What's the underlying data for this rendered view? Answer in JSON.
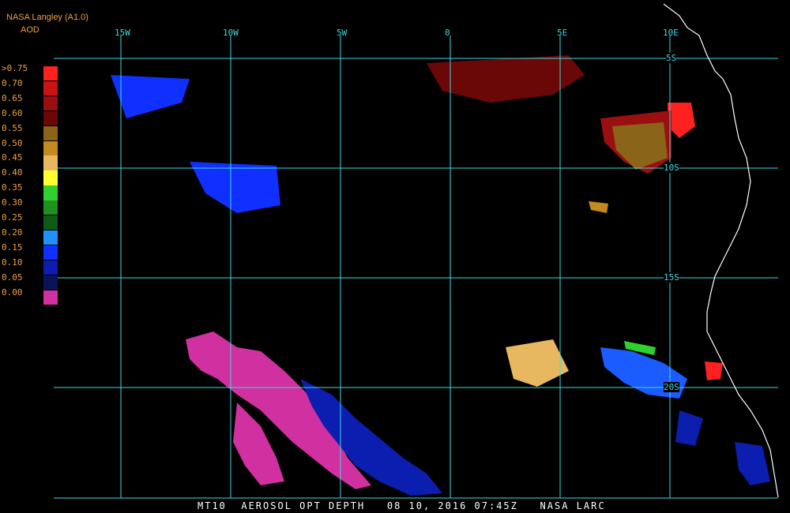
{
  "header": {
    "title": "NASA Langley (A1.0)",
    "product": "AOD"
  },
  "legend": {
    "entries": [
      {
        "label": ">0.75",
        "color": "#ff2020"
      },
      {
        "label": "0.70",
        "color": "#c81414"
      },
      {
        "label": "0.65",
        "color": "#9a1010"
      },
      {
        "label": "0.60",
        "color": "#6a0808"
      },
      {
        "label": "0.55",
        "color": "#8a6418"
      },
      {
        "label": "0.50",
        "color": "#c48a20"
      },
      {
        "label": "0.45",
        "color": "#e8b860"
      },
      {
        "label": "0.40",
        "color": "#ffff30"
      },
      {
        "label": "0.35",
        "color": "#30d030"
      },
      {
        "label": "0.30",
        "color": "#209020"
      },
      {
        "label": "0.25",
        "color": "#0e5a16"
      },
      {
        "label": "0.20",
        "color": "#2090ff"
      },
      {
        "label": "0.15",
        "color": "#1030ff"
      },
      {
        "label": "0.10",
        "color": "#0c1eb0"
      },
      {
        "label": "0.05",
        "color": "#0a145a"
      },
      {
        "label": "0.00",
        "color": "#d030a0"
      }
    ]
  },
  "grid": {
    "lon_labels": [
      "15W",
      "10W",
      "5W",
      "0",
      "5E",
      "10E"
    ],
    "lat_labels": [
      "5S",
      "10S",
      "15S",
      "20S"
    ],
    "color": "#40d8e0"
  },
  "caption": "MT10  AEROSOL OPT DEPTH   08 10, 2016 07:45Z   NASA LARC"
}
